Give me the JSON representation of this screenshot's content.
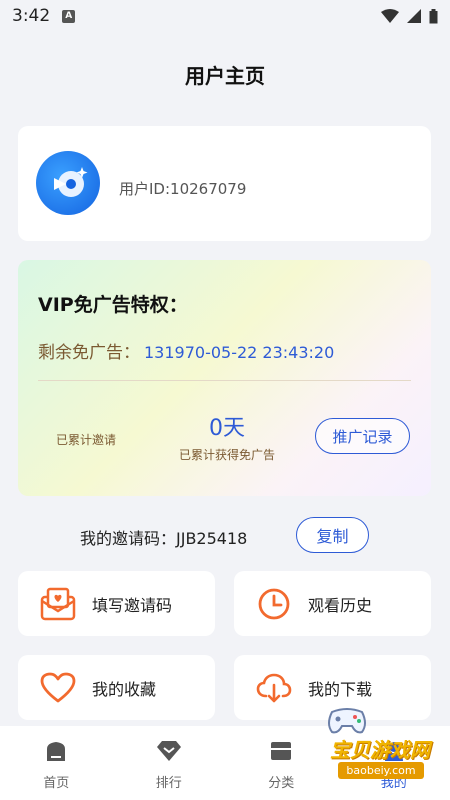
{
  "status_bar": {
    "time": "3:42",
    "badge": "A"
  },
  "header": {
    "title": "用户主页"
  },
  "profile": {
    "user_id": "用户ID:10267079"
  },
  "vip": {
    "title": "VIP免广告特权：",
    "remaining_label": "剩余免广告：",
    "remaining_value": "131970-05-22 23:43:20",
    "invited_label": "已累计邀请",
    "days_value": "0",
    "days_unit": "天",
    "days_label": "已累计获得免广告",
    "promo_button": "推广记录"
  },
  "invite": {
    "label": "我的邀请码：JJB25418",
    "copy_button": "复制"
  },
  "grid": [
    {
      "label": "填写邀请码",
      "icon": "invite-envelope-icon"
    },
    {
      "label": "观看历史",
      "icon": "clock-icon"
    },
    {
      "label": "我的收藏",
      "icon": "heart-icon"
    },
    {
      "label": "我的下载",
      "icon": "download-cloud-icon"
    }
  ],
  "tabs": [
    {
      "label": "首页",
      "icon": "home-icon"
    },
    {
      "label": "排行",
      "icon": "rank-diamond-icon"
    },
    {
      "label": "分类",
      "icon": "category-icon"
    },
    {
      "label": "我的",
      "icon": "profile-icon"
    }
  ],
  "watermark": {
    "title": "宝贝游戏网",
    "url": "baobeiy.com"
  },
  "colors": {
    "accent": "#2e5bd6",
    "icon_orange": "#f26a2e",
    "brown_text": "#7b5a32"
  }
}
